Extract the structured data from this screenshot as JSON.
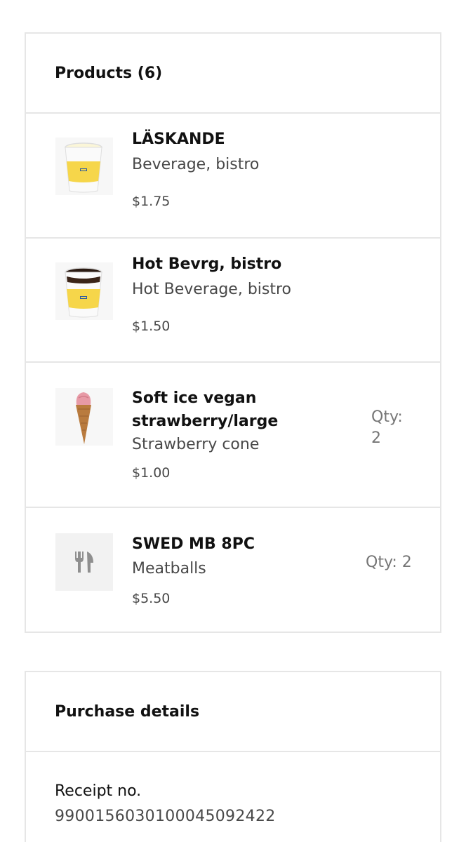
{
  "products": {
    "title": "Products (6)",
    "items": [
      {
        "name": "LÄSKANDE",
        "description": "Beverage, bistro",
        "price": "$1.75",
        "qty": "",
        "image": "cold-cup-icon"
      },
      {
        "name": "Hot Bevrg, bistro",
        "description": "Hot Beverage, bistro",
        "price": "$1.50",
        "qty": "",
        "image": "hot-cup-icon"
      },
      {
        "name_line1": "Soft ice vegan",
        "name_line2": "strawberry/large",
        "description": "Strawberry cone",
        "price": "$1.00",
        "qty_line1": "Qty:",
        "qty_line2": "2",
        "image": "ice-cream-cone-icon"
      },
      {
        "name": "SWED MB 8PC",
        "description": "Meatballs",
        "price": "$5.50",
        "qty": "Qty: 2",
        "image": "fork-knife-icon"
      }
    ]
  },
  "purchase": {
    "title": "Purchase details",
    "receipt_label": "Receipt no.",
    "receipt_value": "990015603010004509242​2"
  },
  "colors": {
    "border": "#e6e6e6",
    "text": "#111111",
    "muted": "#484848",
    "qty": "#767676",
    "cup_yellow": "#f6d64a"
  }
}
